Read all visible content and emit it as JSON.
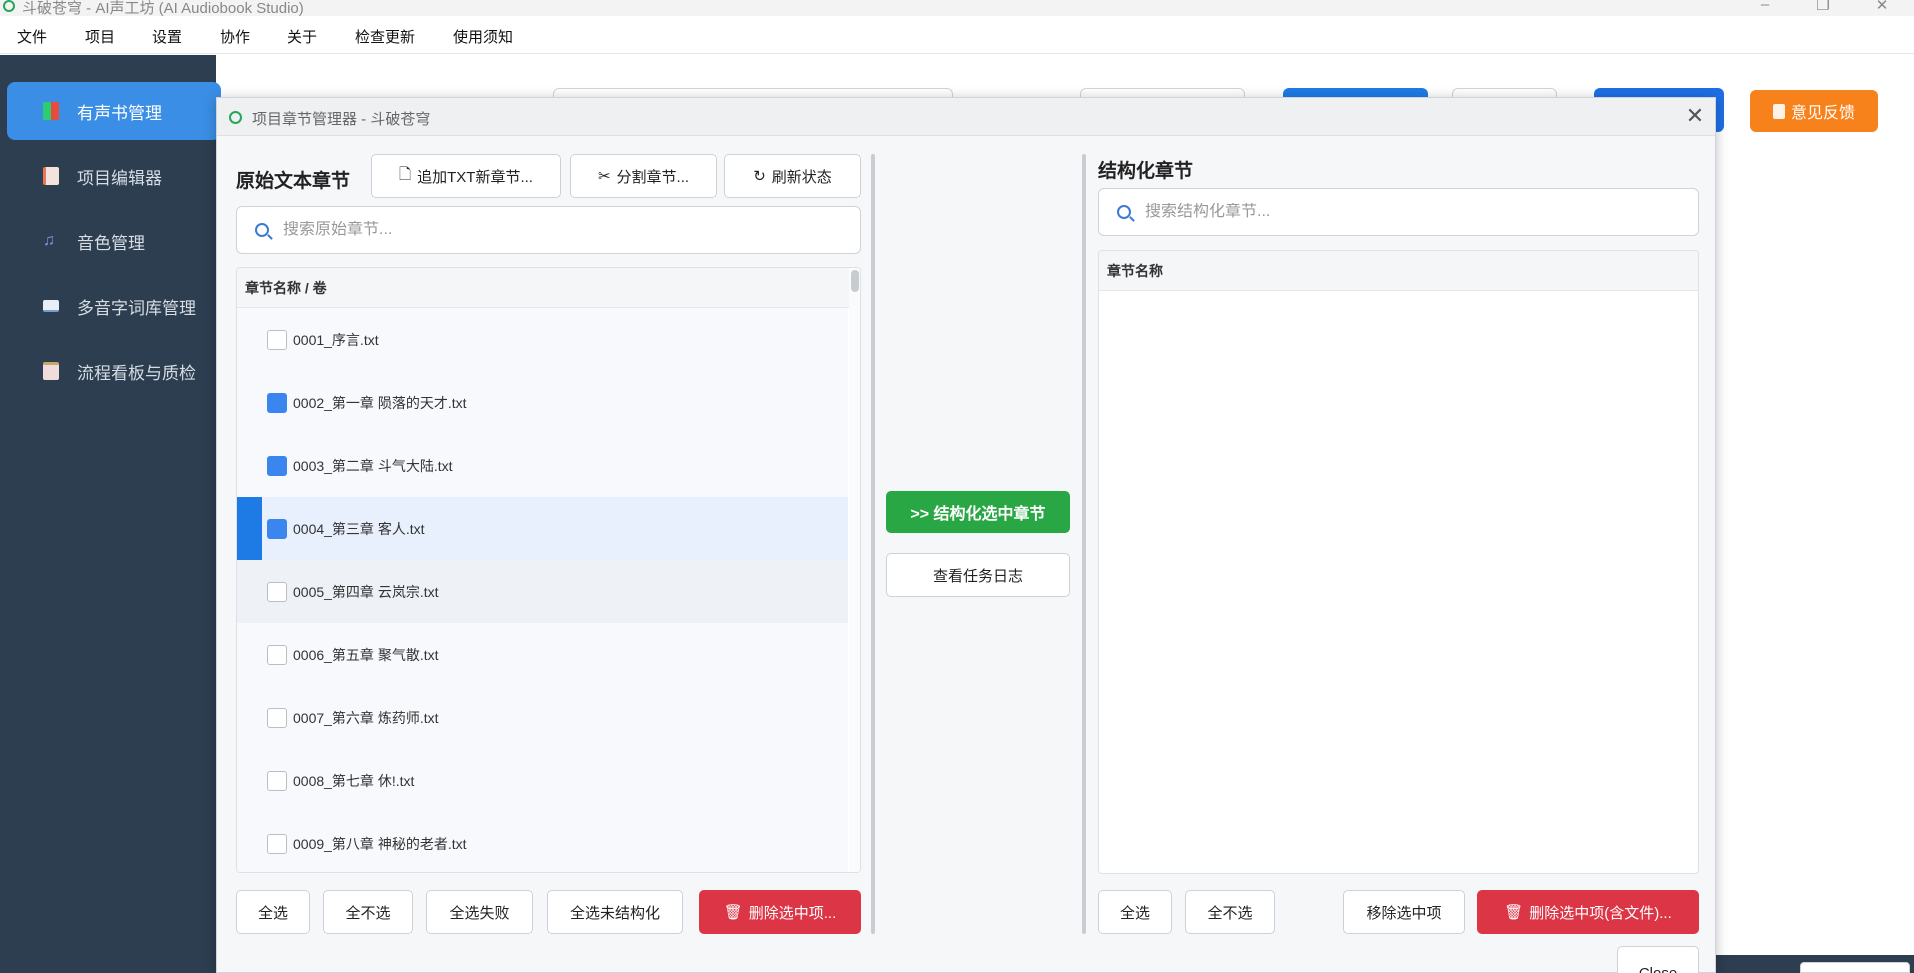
{
  "window": {
    "title": "斗破苍穹 - AI声工坊 (AI Audiobook Studio)"
  },
  "menubar": {
    "items": [
      "文件",
      "项目",
      "设置",
      "协作",
      "关于",
      "检查更新",
      "使用须知"
    ]
  },
  "sidebar": {
    "items": [
      {
        "label": "有声书管理",
        "icon": "audiobook-icon",
        "active": true
      },
      {
        "label": "项目编辑器",
        "icon": "document-icon",
        "active": false
      },
      {
        "label": "音色管理",
        "icon": "music-note-icon",
        "active": false
      },
      {
        "label": "多音字词库管理",
        "icon": "book-icon",
        "active": false
      },
      {
        "label": "流程看板与质检",
        "icon": "clipboard-icon",
        "active": false
      }
    ]
  },
  "header": {
    "feedback_label": "意见反馈"
  },
  "dialog": {
    "title": "项目章节管理器 - 斗破苍穹",
    "left": {
      "title": "原始文本章节",
      "add_txt_label": "追加TXT新章节...",
      "split_label": "分割章节...",
      "refresh_label": "刷新状态",
      "search_placeholder": "搜索原始章节...",
      "column_header": "章节名称 / 卷",
      "rows": [
        {
          "name": "0001_序言.txt",
          "checked": false
        },
        {
          "name": "0002_第一章 陨落的天才.txt",
          "checked": true
        },
        {
          "name": "0003_第二章 斗气大陆.txt",
          "checked": true
        },
        {
          "name": "0004_第三章 客人.txt",
          "checked": true
        },
        {
          "name": "0005_第四章 云岚宗.txt",
          "checked": false
        },
        {
          "name": "0006_第五章 聚气散.txt",
          "checked": false
        },
        {
          "name": "0007_第六章 炼药师.txt",
          "checked": false
        },
        {
          "name": "0008_第七章 休!.txt",
          "checked": false
        },
        {
          "name": "0009_第八章 神秘的老者.txt",
          "checked": false
        }
      ],
      "select_all": "全选",
      "select_none": "全不选",
      "select_failed": "全选失败",
      "select_unstructured": "全选未结构化",
      "delete_selected": "删除选中项..."
    },
    "middle": {
      "structure_label": ">> 结构化选中章节",
      "view_log_label": "查看任务日志"
    },
    "right": {
      "title": "结构化章节",
      "search_placeholder": "搜索结构化章节...",
      "column_header": "章节名称",
      "select_all": "全选",
      "select_none": "全不选",
      "remove_selected": "移除选中项",
      "delete_selected_files": "删除选中项(含文件)..."
    },
    "close_label": "Close"
  },
  "colors": {
    "sidebar_bg": "#2c3e50",
    "sidebar_active": "#3a8ee6",
    "feedback": "#f7821b",
    "success": "#2aa745",
    "danger": "#dc3545",
    "checkbox_checked": "#3a86ee"
  }
}
